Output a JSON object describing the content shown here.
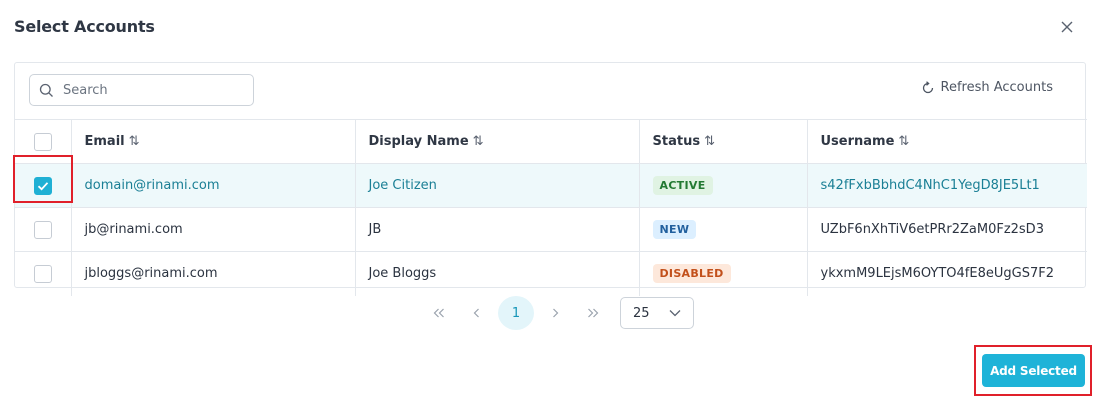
{
  "dialog": {
    "title": "Select Accounts",
    "close_icon": "close-icon"
  },
  "toolbar": {
    "search_placeholder": "Search",
    "refresh_label": "Refresh Accounts"
  },
  "table": {
    "columns": [
      "Email",
      "Display Name",
      "Status",
      "Username"
    ],
    "sort_glyph": "⇅",
    "rows": [
      {
        "checked": true,
        "email": "domain@rinami.com",
        "display_name": "Joe Citizen",
        "status": "ACTIVE",
        "username": "s42fFxbBbhdC4NhC1YegD8JE5Lt1"
      },
      {
        "checked": false,
        "email": "jb@rinami.com",
        "display_name": "JB",
        "status": "NEW",
        "username": "UZbF6nXhTiV6etPRr2ZaM0Fz2sD3"
      },
      {
        "checked": false,
        "email": "jbloggs@rinami.com",
        "display_name": "Joe Bloggs",
        "status": "DISABLED",
        "username": "ykxmM9LEjsM6OYTO4fE8eUgGS7F2"
      }
    ]
  },
  "pagination": {
    "current_page": "1",
    "page_size": "25"
  },
  "footer": {
    "add_label": "Add Selected"
  },
  "colors": {
    "accent": "#1eb3d8",
    "highlight": "#e0202a"
  }
}
